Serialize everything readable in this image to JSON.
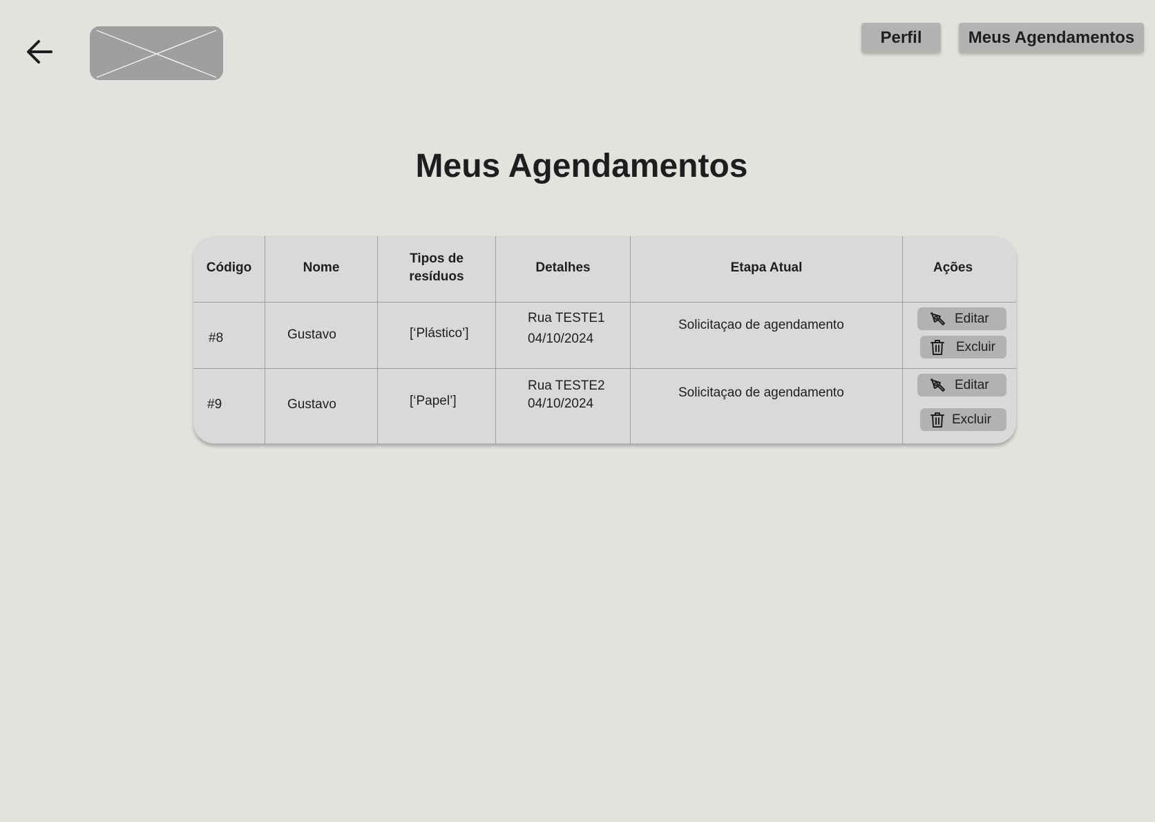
{
  "header": {
    "back_icon": "arrow-left-icon",
    "logo": "image-placeholder",
    "nav": {
      "perfil_label": "Perfil",
      "agendamentos_label": "Meus Agendamentos"
    }
  },
  "page": {
    "title": "Meus Agendamentos"
  },
  "table": {
    "columns": {
      "codigo": "Código",
      "nome": "Nome",
      "tipos_line1": "Tipos de",
      "tipos_line2": "resíduos",
      "detalhes": "Detalhes",
      "etapa": "Etapa Atual",
      "acoes": "Ações"
    },
    "rows": [
      {
        "codigo": "#8",
        "nome": "Gustavo",
        "tipos": "[‘Plástico’]",
        "detalhes_rua": "Rua TESTE1",
        "detalhes_data": "04/10/2024",
        "etapa": "Solicitaçao de agendamento",
        "edit_label": "Editar",
        "delete_label": "Excluir"
      },
      {
        "codigo": "#9",
        "nome": "Gustavo",
        "tipos": "[‘Papel’]",
        "detalhes_rua": "Rua TESTE2",
        "detalhes_data": "04/10/2024",
        "etapa": "Solicitaçao de agendamento",
        "edit_label": "Editar",
        "delete_label": "Excluir"
      }
    ]
  },
  "colors": {
    "background": "#e3e2de",
    "table_bg": "#d9d9d9",
    "button_bg": "#b2b2b0",
    "logo_placeholder": "#9f9f9f",
    "text": "#1e1e1e"
  }
}
